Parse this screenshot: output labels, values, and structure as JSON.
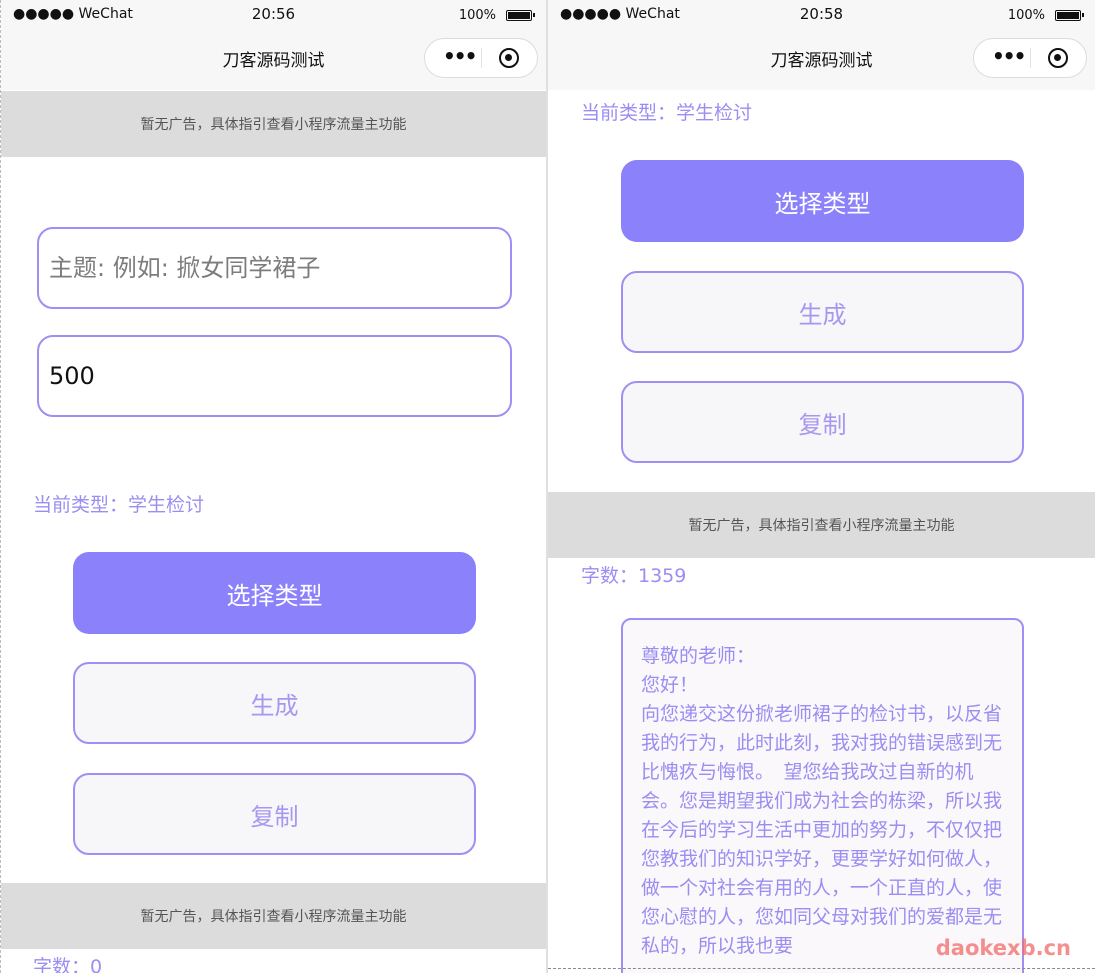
{
  "status_bar": {
    "carrier": "●●●●● WeChat",
    "battery": "100%",
    "time_left": "20:56",
    "time_right": "20:58"
  },
  "nav": {
    "title": "刀客源码测试",
    "more_label": "•••"
  },
  "ad_banner": "暂无广告，具体指引查看小程序流量主功能",
  "form": {
    "topic_placeholder": "主题: 例如: 掀女同学裙子",
    "word_count_value": "500"
  },
  "current_type": "当前类型：学生检讨",
  "buttons": {
    "select_type": "选择类型",
    "generate": "生成",
    "copy": "复制"
  },
  "count_left": "字数：0",
  "count_right": "字数：1359",
  "result": {
    "greeting": "尊敬的老师：",
    "hello": "您好！",
    "body": "向您递交这份掀老师裙子的检讨书，以反省我的行为，此时此刻，我对我的错误感到无比愧疚与悔恨。　望您给我改过自新的机会。您是期望我们成为社会的栋梁，所以我在今后的学习生活中更加的努力，不仅仅把您教我们的知识学好，更要学好如何做人，做一个对社会有用的人，一个正直的人，使您心慰的人，您如同父母对我们的爱都是无私的，所以我也要"
  },
  "watermark": "daokexb.cn"
}
